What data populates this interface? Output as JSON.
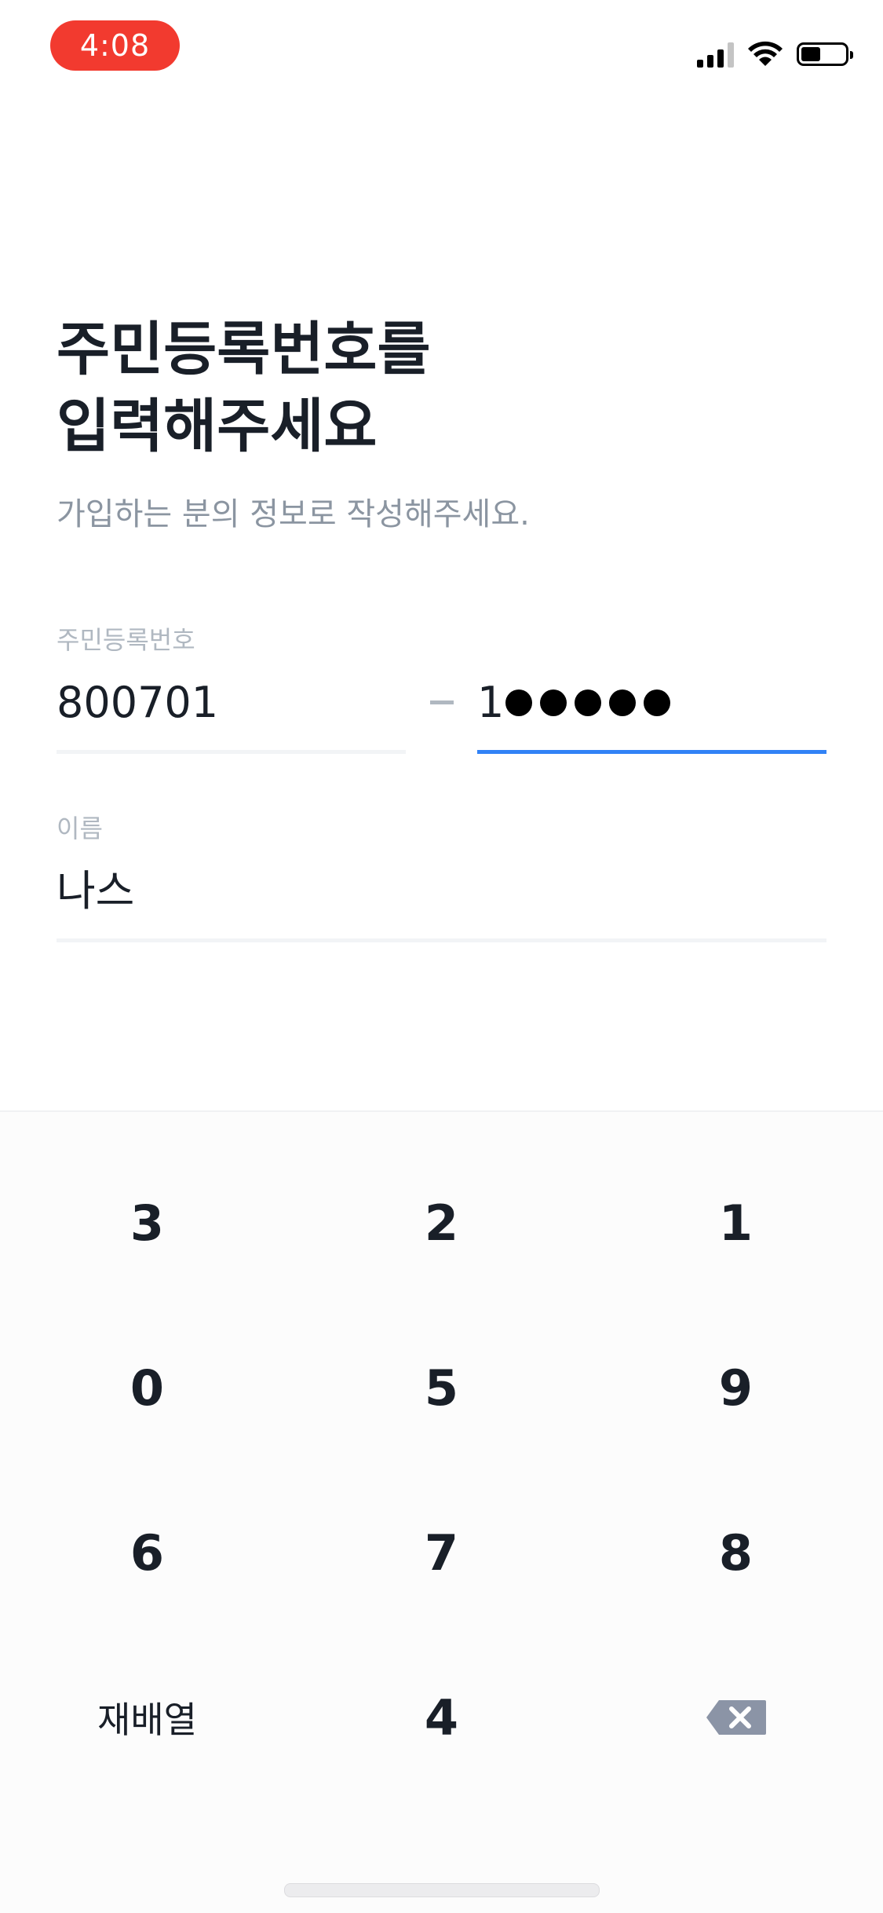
{
  "status_bar": {
    "time": "4:08"
  },
  "header": {
    "title": "주민등록번호를\n입력해주세요",
    "subtitle": "가입하는 분의 정보로 작성해주세요."
  },
  "rrn_field": {
    "label": "주민등록번호",
    "front_value": "800701",
    "back_first_digit": "1",
    "masked_count": 5
  },
  "name_field": {
    "label": "이름",
    "value": "나스"
  },
  "keypad": {
    "keys": [
      "3",
      "2",
      "1",
      "0",
      "5",
      "9",
      "6",
      "7",
      "8",
      "재배열",
      "4",
      "backspace"
    ],
    "accent_color": "#3182f6"
  },
  "icons": [
    "signal-icon",
    "wifi-icon",
    "battery-icon",
    "backspace-icon"
  ]
}
